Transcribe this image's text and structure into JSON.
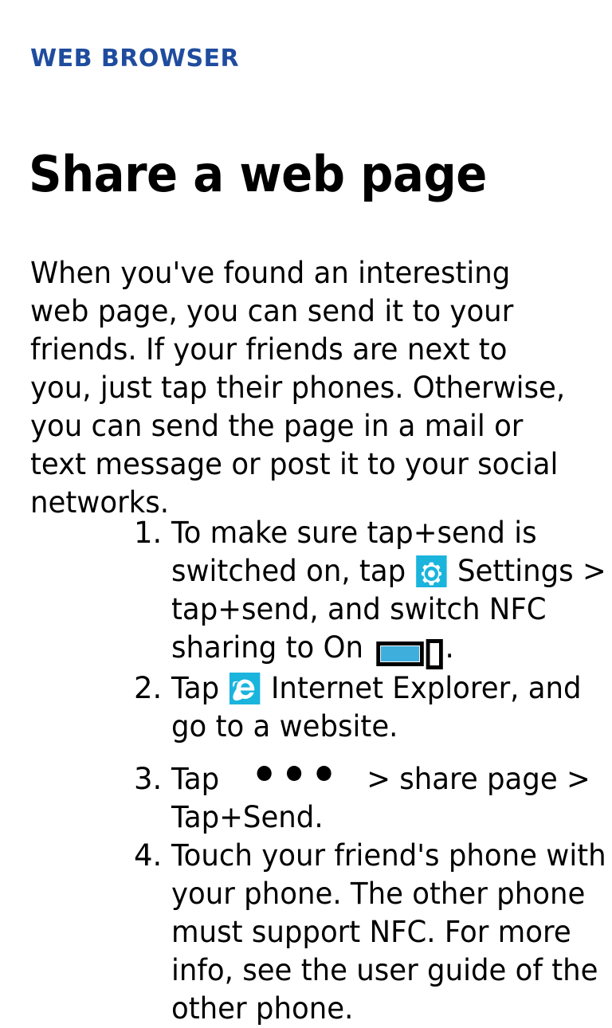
{
  "category": {
    "label": "WEB BROWSER"
  },
  "page_title": "Share a web page",
  "intro": "When you've found an interesting web page, you can send it to your friends. If your friends are next to you, just tap their phones. Otherwise, you can send the page in a mail or text message or post it to your social networks.",
  "steps": [
    {
      "number": "1.",
      "text_before_icon": "To make sure tap+send is switched on, tap ",
      "icon": "settings-gear-icon",
      "text_after_icon": " Settings > tap+send, and switch NFC sharing to On ",
      "trailing_icon": "toggle-switch-on",
      "text_end": "."
    },
    {
      "number": "2.",
      "text_before_icon": "Tap ",
      "icon": "internet-explorer-icon",
      "text_after_icon": " Internet Explorer, and go to a website.",
      "trailing_icon": null,
      "text_end": ""
    },
    {
      "number": "3.",
      "text_before_icon": "Tap ",
      "icon": "more-ellipsis-icon",
      "text_after_icon": "> share page > Tap+Send.",
      "trailing_icon": null,
      "text_end": ""
    },
    {
      "number": "4.",
      "text_before_icon": "Touch your friend's phone with your phone. The other phone must support NFC. For more info, see the user guide of the other phone.",
      "icon": null,
      "text_after_icon": "",
      "trailing_icon": null,
      "text_end": ""
    }
  ],
  "colors": {
    "category_blue": "#1f4c9e",
    "tile_cyan": "#1ab4dd",
    "toggle_cyan": "#3eaedd",
    "text_black": "#000000",
    "background": "#ffffff"
  }
}
